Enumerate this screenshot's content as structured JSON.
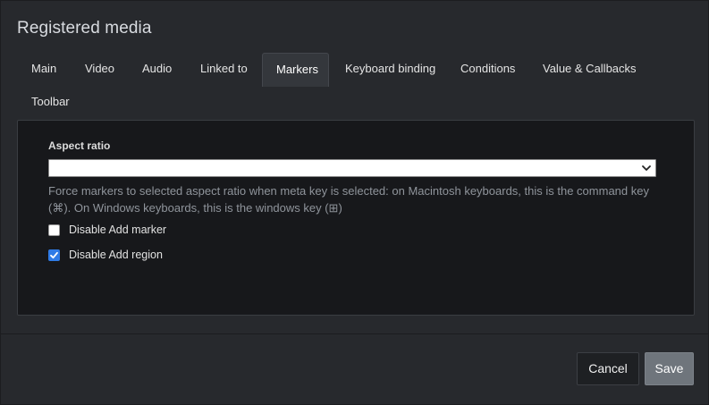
{
  "dialog": {
    "title": "Registered media"
  },
  "tabs": [
    {
      "label": "Main"
    },
    {
      "label": "Video"
    },
    {
      "label": "Audio"
    },
    {
      "label": "Linked to"
    },
    {
      "label": "Markers",
      "active": true
    },
    {
      "label": "Keyboard binding"
    },
    {
      "label": "Conditions"
    },
    {
      "label": "Value & Callbacks"
    },
    {
      "label": "Toolbar"
    }
  ],
  "markers": {
    "aspect_ratio_label": "Aspect ratio",
    "aspect_ratio_value": "",
    "help_text": "Force markers to selected aspect ratio when meta key is selected: on Macintosh keyboards, this is the command key (⌘). On Windows keyboards, this is the windows key (⊞)",
    "checkboxes": [
      {
        "label": "Disable Add marker",
        "checked": false
      },
      {
        "label": "Disable Add region",
        "checked": true
      }
    ]
  },
  "footer": {
    "cancel_label": "Cancel",
    "save_label": "Save"
  },
  "colors": {
    "background": "#27292d",
    "panel": "#17181b",
    "active_tab": "#34373c",
    "checkbox_accent": "#2f7be6",
    "save_button": "#6f757c"
  }
}
